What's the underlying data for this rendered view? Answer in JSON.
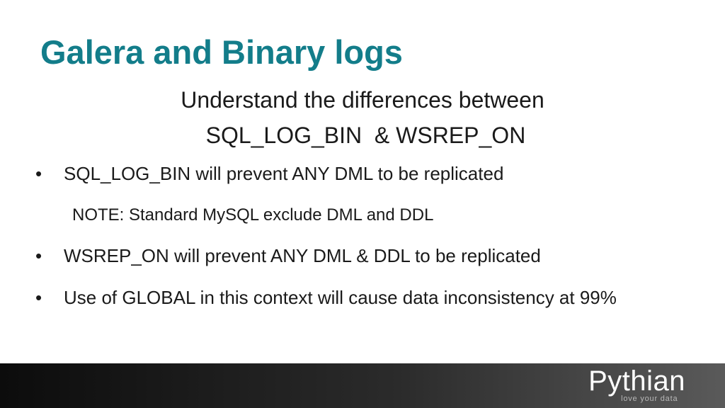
{
  "slide": {
    "title": "Galera and Binary logs",
    "subtitle_line1": "Understand the differences between",
    "subtitle_line2": " SQL_LOG_BIN  & WSREP_ON",
    "bullet_symbol": "•",
    "bullets": [
      {
        "text": "SQL_LOG_BIN will prevent ANY DML to be replicated"
      },
      {
        "text": "WSREP_ON will prevent ANY DML & DDL to be replicated"
      },
      {
        "text": "Use of GLOBAL in this context will cause data inconsistency at 99%"
      }
    ],
    "note": "NOTE: Standard MySQL exclude DML and DDL"
  },
  "footer": {
    "logo_text": "Pythian",
    "tagline": "love your data"
  },
  "colors": {
    "title": "#137d8a",
    "text": "#1a1a1a",
    "footer_bg": "#1e1e1e",
    "logo": "#ffffff"
  }
}
